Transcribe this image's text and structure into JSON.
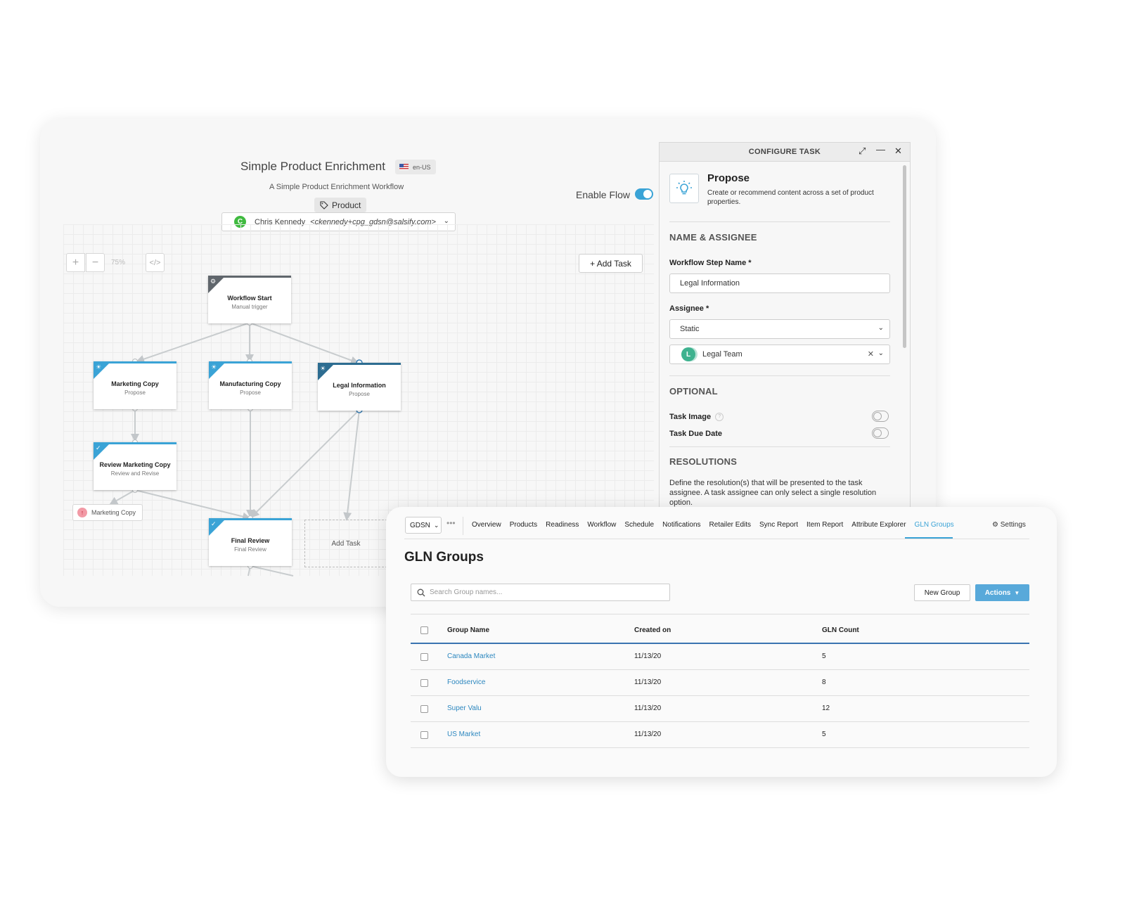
{
  "workflow": {
    "title": "Simple Product Enrichment",
    "locale": "en-US",
    "subtitle": "A Simple Product Enrichment Workflow",
    "tag": "Product",
    "owner": {
      "initial": "C",
      "name": "Chris Kennedy",
      "email": "<ckennedy+cpg_gdsn@salsify.com>"
    },
    "enable_label": "Enable Flow",
    "enabled": true,
    "zoom_in": "+",
    "zoom_out": "−",
    "zoom_level": "75%",
    "code_icon": "</>",
    "add_task_button": "+ Add Task",
    "nodes": {
      "start": {
        "title": "Workflow Start",
        "sub": "Manual trigger",
        "icon": "gear-icon"
      },
      "marketing": {
        "title": "Marketing Copy",
        "sub": "Propose",
        "icon": "lightbulb-icon"
      },
      "manufacturing": {
        "title": "Manufacturing Copy",
        "sub": "Propose",
        "icon": "lightbulb-icon"
      },
      "legal": {
        "title": "Legal Information",
        "sub": "Propose",
        "icon": "lightbulb-icon"
      },
      "review": {
        "title": "Review Marketing Copy",
        "sub": "Review and Revise",
        "icon": "check-icon"
      },
      "final": {
        "title": "Final Review",
        "sub": "Final Review",
        "icon": "check-icon"
      },
      "add": "Add Task",
      "chip": "Marketing Copy"
    }
  },
  "configure": {
    "header": "CONFIGURE TASK",
    "task_name": "Propose",
    "task_desc": "Create or recommend content across a set of product properties.",
    "section_name": "NAME & ASSIGNEE",
    "step_label": "Workflow Step Name *",
    "step_value": "Legal Information",
    "assignee_label": "Assignee *",
    "assignee_type": "Static",
    "assignee_initial": "L",
    "assignee_value": "Legal Team",
    "section_optional": "OPTIONAL",
    "task_image": "Task Image",
    "task_image_on": false,
    "task_due": "Task Due Date",
    "task_due_on": false,
    "section_resolutions": "RESOLUTIONS",
    "res_text": "Define the resolution(s) that will be presented to the task assignee. A task assignee can only select a single resolution option."
  },
  "gln": {
    "selector": "GDSN",
    "more": "•••",
    "nav": [
      "Overview",
      "Products",
      "Readiness",
      "Workflow",
      "Schedule",
      "Notifications",
      "Retailer Edits",
      "Sync Report",
      "Item Report",
      "Attribute Explorer",
      "GLN Groups"
    ],
    "active_nav": "GLN Groups",
    "settings": "Settings",
    "title": "GLN Groups",
    "search_placeholder": "Search Group names...",
    "new_group": "New Group",
    "actions": "Actions",
    "columns": [
      "Group Name",
      "Created on",
      "GLN Count"
    ],
    "rows": [
      {
        "name": "Canada Market",
        "created": "11/13/20",
        "count": "5"
      },
      {
        "name": "Foodservice",
        "created": "11/13/20",
        "count": "8"
      },
      {
        "name": "Super Valu",
        "created": "11/13/20",
        "count": "12"
      },
      {
        "name": "US Market",
        "created": "11/13/20",
        "count": "5"
      }
    ],
    "colors": {
      "accent": "#3aa3d6",
      "link": "#2c87bf",
      "header_rule": "#3a74b0"
    }
  }
}
